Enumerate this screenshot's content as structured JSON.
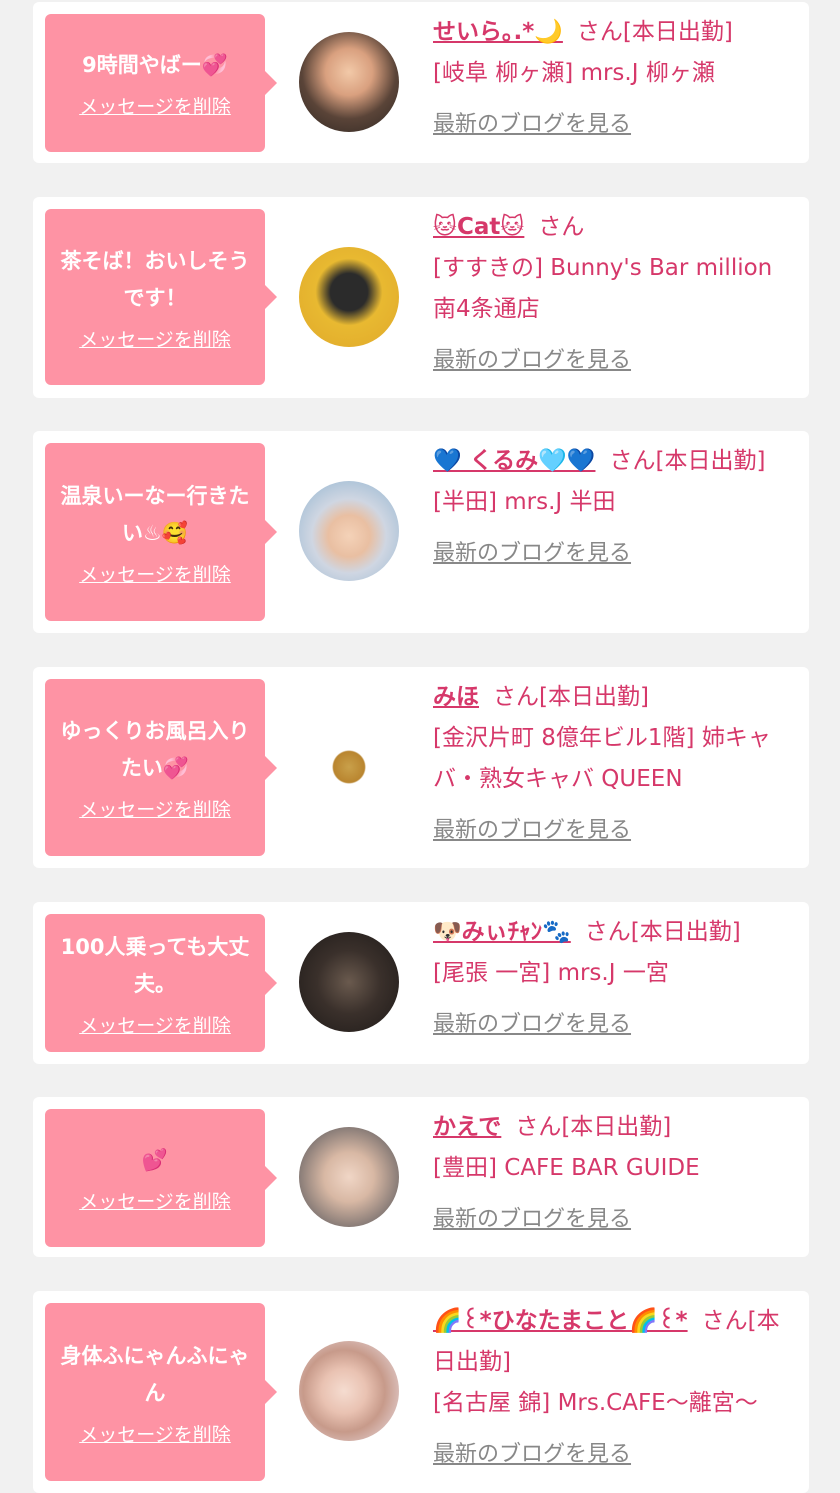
{
  "cards": [
    {
      "message": "9時間やばー💞",
      "delete_label": "メッセージを削除",
      "name": "せいら｡.*🌙",
      "suffix": "さん[本日出勤]",
      "shop": "[岐阜 柳ヶ瀬] mrs.J 柳ヶ瀬",
      "blog_label": "最新のブログを見る"
    },
    {
      "message": "茶そば！おいしそうです！",
      "delete_label": "メッセージを削除",
      "name": "🐱Cat🐱",
      "suffix": "さん",
      "shop": "[すすきの] Bunny's Bar million 南4条通店",
      "blog_label": "最新のブログを見る"
    },
    {
      "message": "温泉いーなー行きたい♨🥰",
      "delete_label": "メッセージを削除",
      "name": "💙 くるみ🩵💙",
      "suffix": "さん[本日出勤]",
      "shop": "[半田] mrs.J 半田",
      "blog_label": "最新のブログを見る"
    },
    {
      "message": "ゆっくりお風呂入りたい💞",
      "delete_label": "メッセージを削除",
      "name": "みほ",
      "suffix": "さん[本日出勤]",
      "shop": "[金沢片町 8億年ビル1階] 姉キャバ・熟女キャバ QUEEN",
      "blog_label": "最新のブログを見る"
    },
    {
      "message": "100人乗っても大丈夫。",
      "delete_label": "メッセージを削除",
      "name": "🐶みぃﾁｬﾝ🐾",
      "suffix": "さん[本日出勤]",
      "shop": "[尾張 一宮] mrs.J 一宮",
      "blog_label": "最新のブログを見る"
    },
    {
      "message": "💕",
      "delete_label": "メッセージを削除",
      "name": "かえで",
      "suffix": "さん[本日出勤]",
      "shop": "[豊田] CAFE BAR GUIDE",
      "blog_label": "最新のブログを見る"
    },
    {
      "message": "身体ふにゃんふにゃん",
      "delete_label": "メッセージを削除",
      "name": "🌈꒰*ひなたまこと🌈꒰*",
      "suffix": "さん[本日出勤]",
      "shop": "[名古屋 錦] Mrs.CAFE〜離宮〜",
      "blog_label": "最新のブログを見る"
    }
  ],
  "avatar_icons": [
    "avatar-icon",
    "avatar-icon",
    "avatar-icon",
    "shop-logo-icon",
    "avatar-icon",
    "avatar-icon",
    "avatar-icon"
  ],
  "colors": {
    "accent": "#d6386a",
    "bubble": "#fe93a4",
    "background": "#f1f1f1",
    "blog_link": "#888888"
  }
}
